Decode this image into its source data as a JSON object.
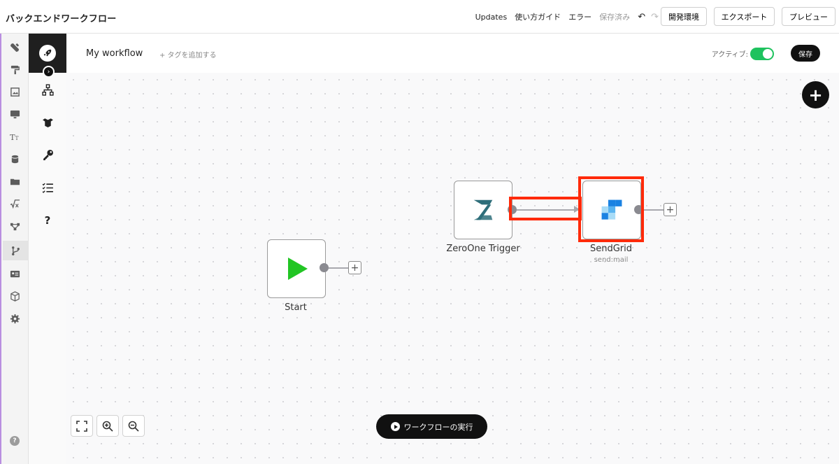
{
  "header": {
    "app_title": "バックエンドワークフロー",
    "links": {
      "updates": "Updates",
      "guide": "使い方ガイド",
      "errors": "エラー",
      "saved": "保存済み"
    },
    "undo_icon": "↶",
    "redo_icon": "↷",
    "buttons": {
      "environment": "開発環境",
      "export": "エクスポート",
      "preview": "プレビュー"
    }
  },
  "workflow": {
    "name": "My workflow",
    "add_tag": "+ タグを追加する",
    "active_label": "アクティブ:",
    "active": true,
    "save_label": "保存"
  },
  "nodes": {
    "start": {
      "label": "Start"
    },
    "zeroone": {
      "label": "ZeroOne Trigger"
    },
    "sendgrid": {
      "label": "SendGrid",
      "sub": "send:mail"
    }
  },
  "canvas": {
    "add_node_icon": "+",
    "run_label": "ワークフローの実行",
    "plus_symbol": "+"
  },
  "colors": {
    "accent_green": "#1ec25e",
    "highlight_red": "#ff2a0a",
    "start_play": "#22c524",
    "zeroone_teal": "#2e6e7a",
    "sendgrid_blue": "#1a82e2"
  }
}
